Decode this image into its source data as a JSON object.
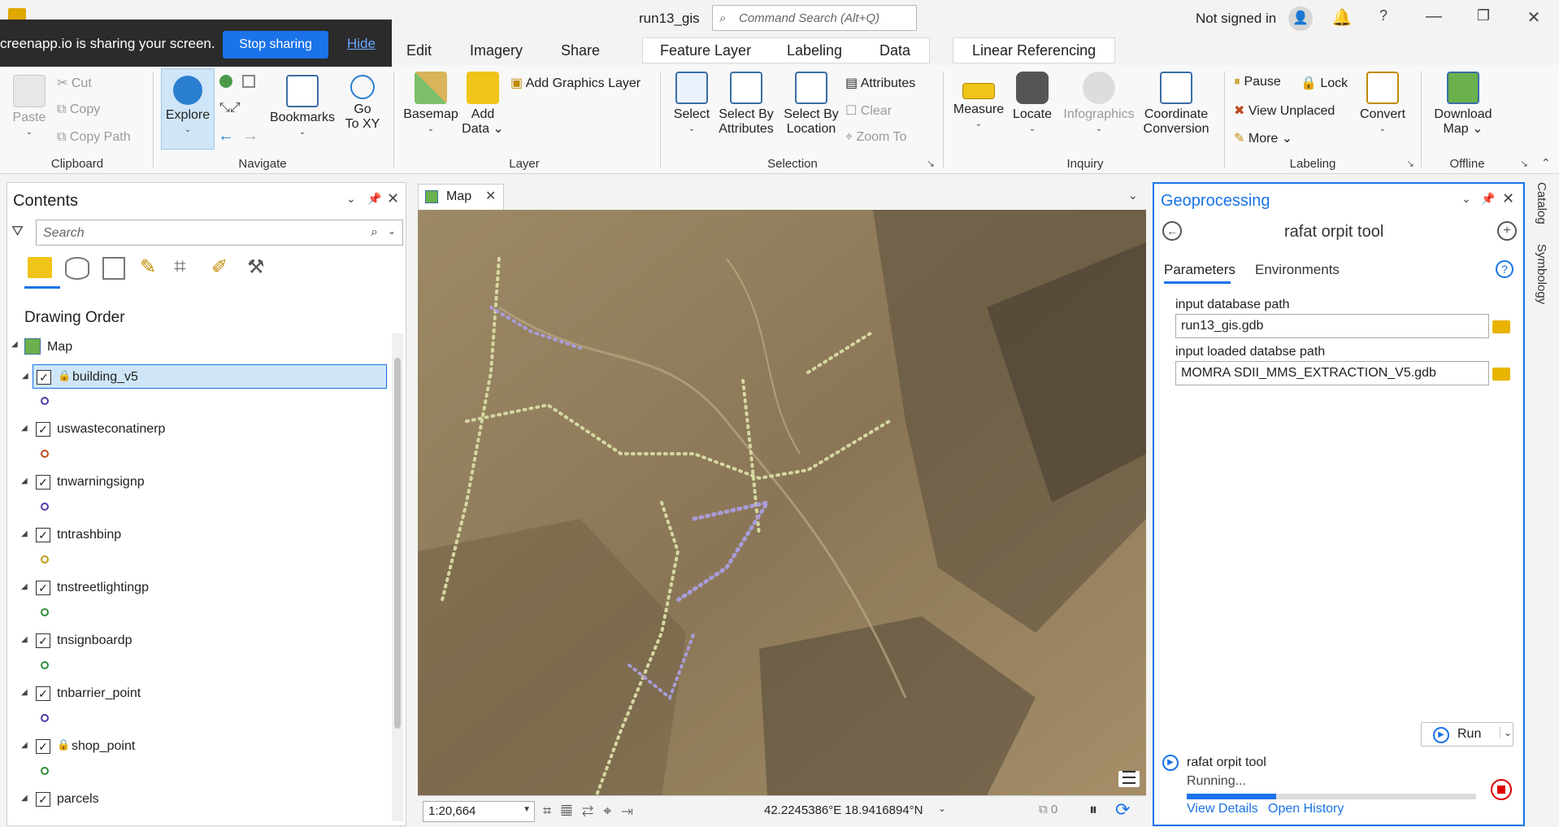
{
  "app": {
    "title": "run13_gis",
    "command_search_placeholder": "Command Search (Alt+Q)",
    "signin": "Not signed in"
  },
  "share_banner": {
    "message": "creenapp.io is sharing your screen.",
    "stop": "Stop sharing",
    "hide": "Hide"
  },
  "ribbon_tabs": {
    "edit": "Edit",
    "imagery": "Imagery",
    "share": "Share",
    "feature_layer": "Feature Layer",
    "labeling": "Labeling",
    "data": "Data",
    "linear_referencing": "Linear Referencing"
  },
  "clipboard": {
    "paste": "Paste",
    "cut": "Cut",
    "copy": "Copy",
    "copy_path": "Copy Path",
    "label": "Clipboard"
  },
  "navigate": {
    "explore": "Explore",
    "bookmarks": "Bookmarks",
    "go_to_xy_1": "Go",
    "go_to_xy_2": "To XY",
    "label": "Navigate"
  },
  "layer": {
    "basemap": "Basemap",
    "add_data_1": "Add",
    "add_data_2": "Data",
    "add_graphics": "Add Graphics Layer",
    "label": "Layer"
  },
  "selection": {
    "select": "Select",
    "sba_1": "Select By",
    "sba_2": "Attributes",
    "sbl_1": "Select By",
    "sbl_2": "Location",
    "attributes": "Attributes",
    "clear": "Clear",
    "zoom_to": "Zoom To",
    "label": "Selection"
  },
  "inquiry": {
    "measure": "Measure",
    "locate": "Locate",
    "infographics": "Infographics",
    "coord_1": "Coordinate",
    "coord_2": "Conversion",
    "label": "Inquiry"
  },
  "labeling_grp": {
    "pause": "Pause",
    "lock": "Lock",
    "view_unplaced": "View Unplaced",
    "more": "More",
    "convert": "Convert",
    "label": "Labeling"
  },
  "offline": {
    "download_1": "Download",
    "download_2": "Map",
    "label": "Offline"
  },
  "contents": {
    "title": "Contents",
    "search_placeholder": "Search",
    "drawing_order": "Drawing Order",
    "map_name": "Map",
    "layers": [
      {
        "name": "building_v5",
        "color": "#4a3ea8"
      },
      {
        "name": "uswasteconatinerp",
        "color": "#c04a20"
      },
      {
        "name": "tnwarningsignp",
        "color": "#5a3aa8"
      },
      {
        "name": "tntrashbinp",
        "color": "#c09a10"
      },
      {
        "name": "tnstreetlightingp",
        "color": "#2f8f3a"
      },
      {
        "name": "tnsignboardp",
        "color": "#2f8f3a"
      },
      {
        "name": "tnbarrier_point",
        "color": "#4a3ea8"
      },
      {
        "name": "shop_point",
        "color": "#2f8f3a"
      },
      {
        "name": "parcels",
        "color": "#333333"
      }
    ]
  },
  "map": {
    "tab": "Map",
    "scale": "1:20,664",
    "coordinates": "42.2245386°E 18.9416894°N",
    "selected_count": "0"
  },
  "geoprocessing": {
    "title": "Geoprocessing",
    "tool_name": "rafat orpit tool",
    "tab_parameters": "Parameters",
    "tab_environments": "Environments",
    "param1_label": "input database path",
    "param1_value": "run13_gis.gdb",
    "param2_label": "input loaded databse path",
    "param2_value": "MOMRA SDII_MMS_EXTRACTION_V5.gdb",
    "run": "Run",
    "status_tool": "rafat orpit tool",
    "status_text": "Running...",
    "progress": 0.31,
    "view_details": "View Details",
    "open_history": "Open History"
  },
  "side_tabs": {
    "catalog": "Catalog",
    "symbology": "Symbology"
  }
}
